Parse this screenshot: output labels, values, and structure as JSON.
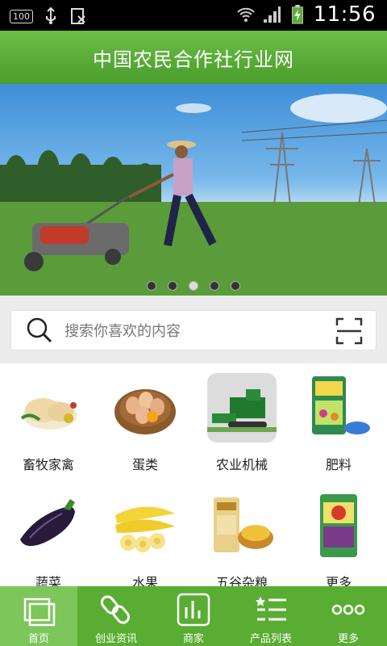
{
  "status_bar": {
    "battery_level": "100",
    "time": "11:56"
  },
  "header": {
    "title": "中国农民合作社行业网"
  },
  "banner": {
    "slide_count": 5,
    "active_slide": 3
  },
  "search": {
    "placeholder": "搜索你喜欢的内容"
  },
  "categories": [
    {
      "label": "畜牧家禽",
      "icon": "poultry-icon"
    },
    {
      "label": "蛋类",
      "icon": "eggs-icon"
    },
    {
      "label": "农业机械",
      "icon": "harvester-icon"
    },
    {
      "label": "肥料",
      "icon": "fertilizer-icon"
    },
    {
      "label": "蔬菜",
      "icon": "eggplant-icon"
    },
    {
      "label": "水果",
      "icon": "banana-icon"
    },
    {
      "label": "五谷杂粮",
      "icon": "grain-icon"
    },
    {
      "label": "更多",
      "icon": "rice-bag-icon"
    }
  ],
  "tabs": [
    {
      "label": "首页",
      "icon": "home-icon",
      "active": true
    },
    {
      "label": "创业资讯",
      "icon": "link-icon",
      "active": false
    },
    {
      "label": "商家",
      "icon": "bar-chart-icon",
      "active": false
    },
    {
      "label": "产品列表",
      "icon": "list-icon",
      "active": false
    },
    {
      "label": "更多",
      "icon": "more-dots-icon",
      "active": false
    }
  ],
  "colors": {
    "brand_green": "#5aad33",
    "header_green": "#6cbf46"
  }
}
